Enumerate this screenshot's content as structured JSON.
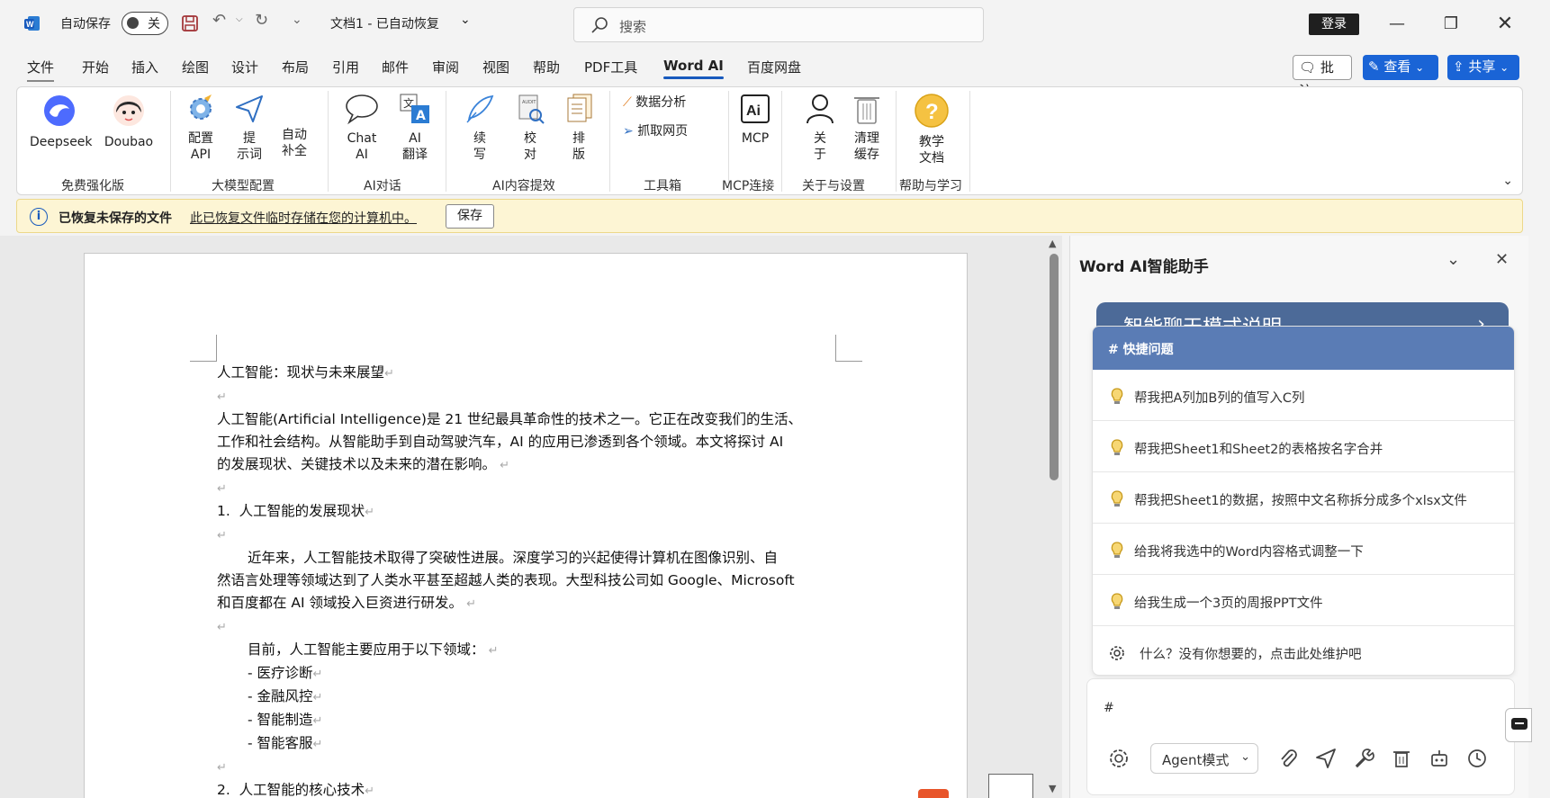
{
  "titlebar": {
    "autosave_label": "自动保存",
    "autosave_state": "关",
    "doc_title": "文档1  -  已自动恢复",
    "search_placeholder": "搜索",
    "login_label": "登录"
  },
  "menu": {
    "items": [
      "文件",
      "开始",
      "插入",
      "绘图",
      "设计",
      "布局",
      "引用",
      "邮件",
      "审阅",
      "视图",
      "帮助",
      "PDF工具",
      "Word AI",
      "百度网盘"
    ],
    "active": "Word AI",
    "comment_label": "批注",
    "view_label": "查看",
    "share_label": "共享"
  },
  "ribbon": {
    "groups": [
      {
        "label": "免费强化版",
        "buttons": [
          "Deepseek",
          "Doubao"
        ]
      },
      {
        "label": "大模型配置",
        "buttons": [
          "配置\nAPI",
          "提\n示词",
          "自动\n补全"
        ]
      },
      {
        "label": "AI对话",
        "buttons": [
          "Chat\nAI",
          "AI\n翻译"
        ]
      },
      {
        "label": "AI内容提效",
        "buttons": [
          "续\n写",
          "校\n对",
          "排\n版"
        ]
      },
      {
        "label": "工具箱",
        "buttons": [
          "数据分析",
          "抓取网页"
        ]
      },
      {
        "label": "MCP连接",
        "buttons": [
          "MCP"
        ]
      },
      {
        "label": "关于与设置",
        "buttons": [
          "关\n于",
          "清理\n缓存"
        ]
      },
      {
        "label": "帮助与学习",
        "buttons": [
          "教学\n文档"
        ]
      }
    ]
  },
  "notice": {
    "title": "已恢复未保存的文件",
    "message": "此已恢复文件临时存储在您的计算机中。",
    "save_label": "保存"
  },
  "document": {
    "lines": [
      "人工智能：现状与未来展望",
      "",
      "人工智能(Artificial Intelligence)是 21 世纪最具革命性的技术之一。它正在改变我们的生活、",
      "工作和社会结构。从智能助手到自动驾驶汽车，AI 的应用已渗透到各个领域。本文将探讨 AI",
      "的发展现状、关键技术以及未来的潜在影响。",
      "",
      "1.  人工智能的发展现状",
      "",
      "近年来，人工智能技术取得了突破性进展。深度学习的兴起使得计算机在图像识别、自",
      "然语言处理等领域达到了人类水平甚至超越人类的表现。大型科技公司如 Google、Microsoft",
      "和百度都在 AI 领域投入巨资进行研发。",
      "",
      "目前，人工智能主要应用于以下领域：",
      "- 医疗诊断",
      "- 金融风控",
      "- 智能制造",
      "- 智能客服",
      "",
      "2.  人工智能的核心技术"
    ]
  },
  "panel": {
    "title": "Word AI智能助手",
    "mode_banner": "智能聊天模式说明",
    "quick_header": "# 快捷问题",
    "quick_items": [
      "帮我把A列加B列的值写入C列",
      "帮我把Sheet1和Sheet2的表格按名字合并",
      "帮我把Sheet1的数据，按照中文名称拆分成多个xlsx文件",
      "给我将我选中的Word内容格式调整一下",
      "给我生成一个3页的周报PPT文件"
    ],
    "maintain_text": "什么？没有你想要的，点击此处维护吧",
    "input_text": "#",
    "mode_select": "Agent模式"
  }
}
